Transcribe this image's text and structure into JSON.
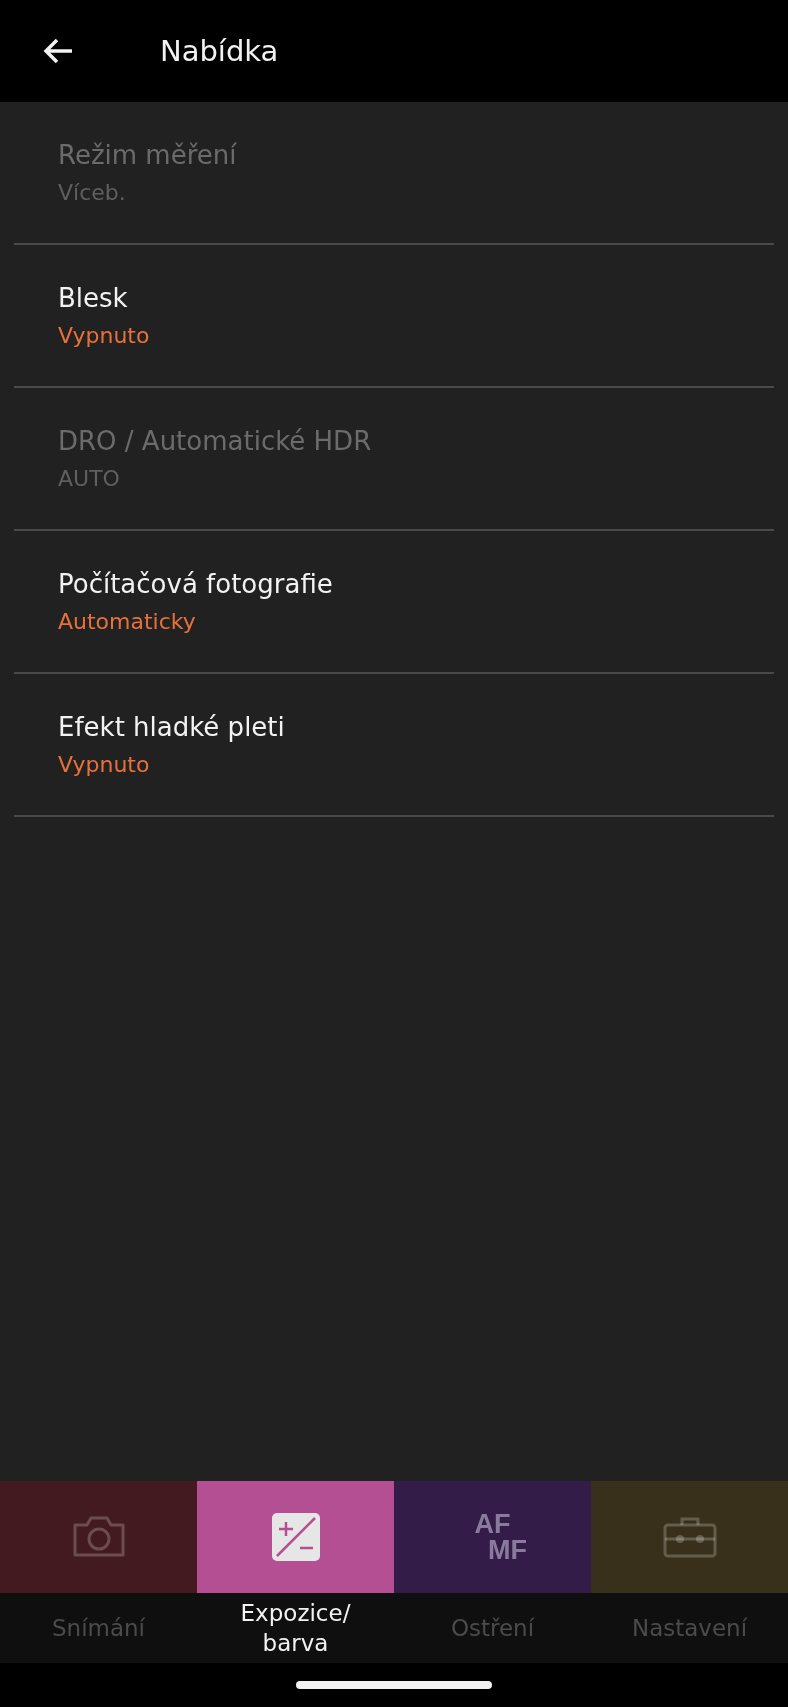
{
  "header": {
    "title": "Nabídka"
  },
  "settings": [
    {
      "label": "Režim měření",
      "value": "Víceb.",
      "disabled": true
    },
    {
      "label": "Blesk",
      "value": "Vypnuto",
      "disabled": false
    },
    {
      "label": "DRO / Automatické HDR",
      "value": "AUTO",
      "disabled": true
    },
    {
      "label": "Počítačová fotografie",
      "value": "Automaticky",
      "disabled": false
    },
    {
      "label": "Efekt hladké pleti",
      "value": "Vypnuto",
      "disabled": false
    }
  ],
  "tabs": [
    {
      "kind": "camera",
      "label": "Snímání",
      "selected": false,
      "color": "#431a20"
    },
    {
      "kind": "exposure",
      "label": "Expozice/\nbarva",
      "selected": true,
      "color": "#b54f93"
    },
    {
      "kind": "focus",
      "label": "Ostření",
      "selected": false,
      "color": "#331c48",
      "icon_text": [
        "AF",
        "MF"
      ]
    },
    {
      "kind": "toolbox",
      "label": "Nastavení",
      "selected": false,
      "color": "#38301a"
    }
  ]
}
